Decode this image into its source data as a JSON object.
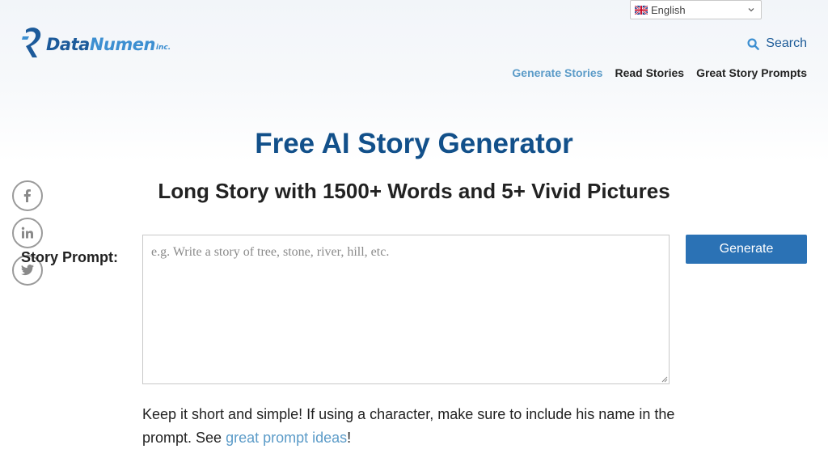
{
  "language": {
    "selected": "English"
  },
  "logo": {
    "name_a": "Data",
    "name_b": "Numen",
    "suffix": "inc."
  },
  "search": {
    "label": "Search"
  },
  "nav": {
    "items": [
      {
        "label": "Generate Stories"
      },
      {
        "label": "Read Stories"
      },
      {
        "label": "Great Story Prompts"
      }
    ]
  },
  "main": {
    "title": "Free AI Story Generator",
    "subtitle": "Long Story with 1500+ Words and 5+ Vivid Pictures",
    "prompt_label": "Story Prompt:",
    "prompt_placeholder": "e.g. Write a story of tree, stone, river, hill, etc.",
    "generate_label": "Generate",
    "hint_before": "Keep it short and simple! If using a character, make sure to include his name in the prompt. See ",
    "hint_link": "great prompt ideas",
    "hint_after": "!"
  },
  "social": [
    "facebook-icon",
    "linkedin-icon",
    "twitter-icon"
  ],
  "colors": {
    "brand": "#12508a",
    "accent": "#5b9bc8",
    "button": "#2b72b5"
  }
}
